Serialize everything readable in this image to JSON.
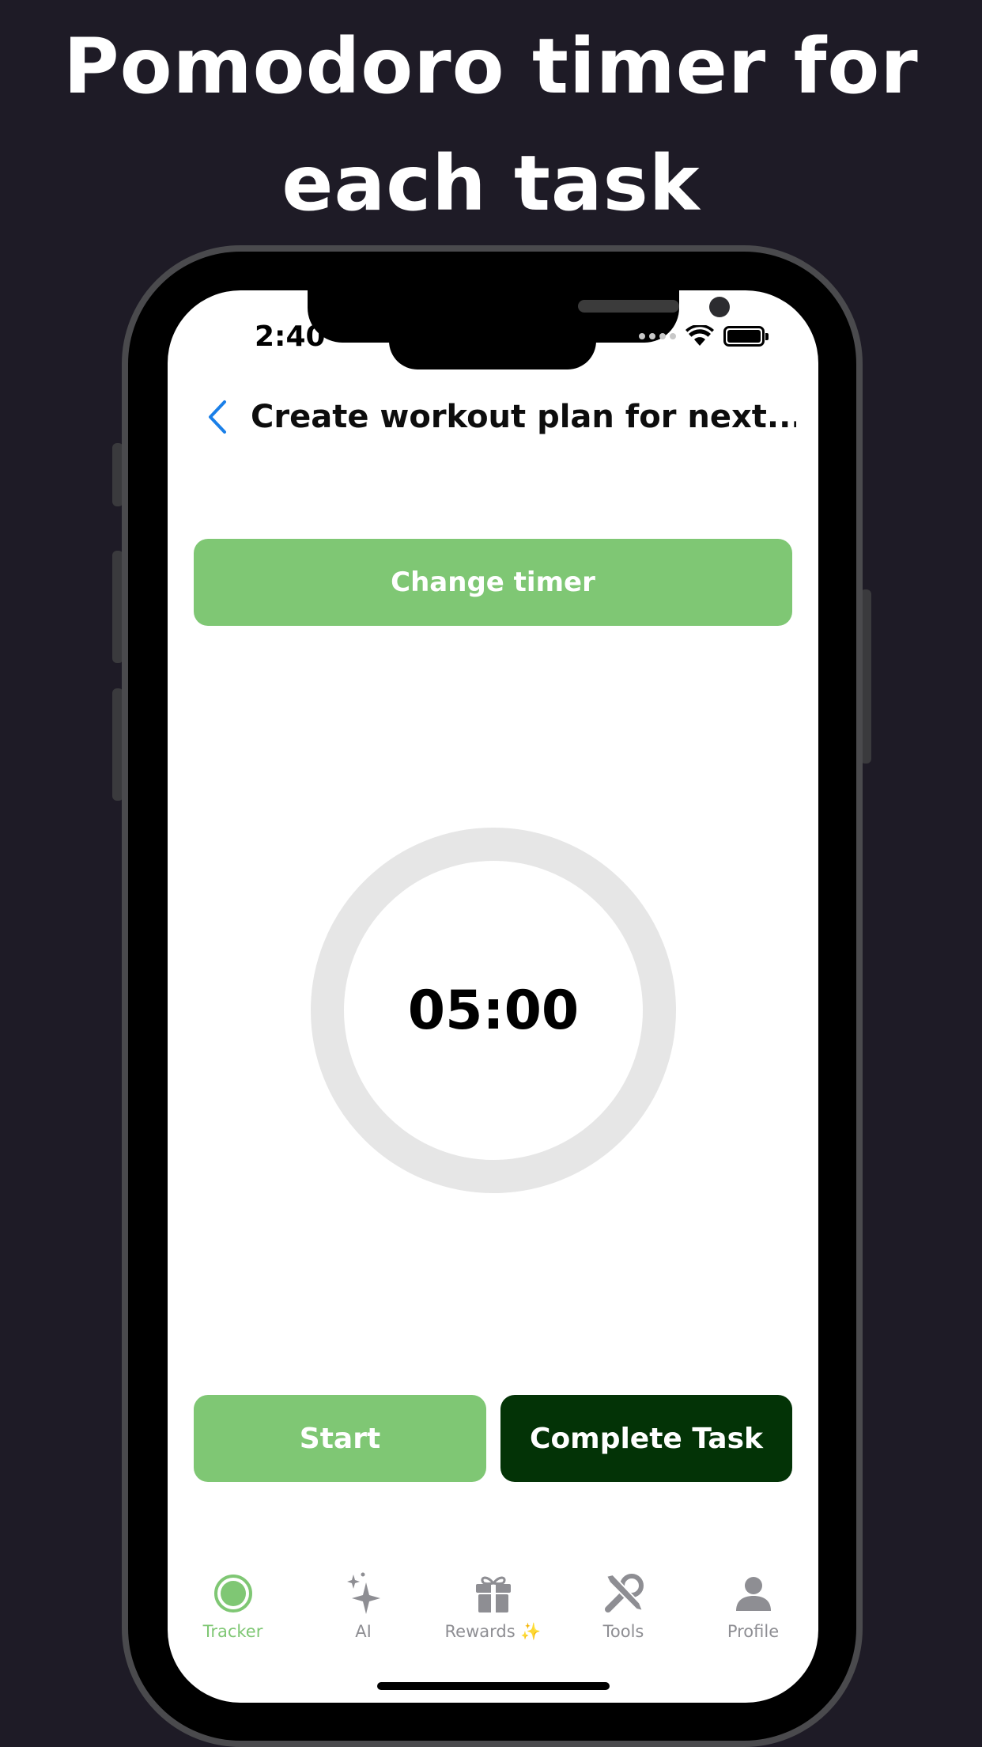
{
  "headline": {
    "line1": "Pomodoro timer for",
    "line2": "each task"
  },
  "status_bar": {
    "time": "2:40",
    "icons": [
      "cellular-signal-icon",
      "wifi-icon",
      "battery-icon"
    ]
  },
  "header": {
    "back_icon": "chevron-left-icon",
    "title": "Create workout plan for next..."
  },
  "buttons": {
    "change_timer": "Change timer",
    "start": "Start",
    "complete_task": "Complete Task"
  },
  "timer": {
    "display": "05:00"
  },
  "tabbar": {
    "items": [
      {
        "label": "Tracker",
        "icon": "tracker-circle-icon",
        "active": true
      },
      {
        "label": "AI",
        "icon": "sparkles-icon",
        "active": false
      },
      {
        "label": "Rewards ✨",
        "icon": "gift-icon",
        "active": false
      },
      {
        "label": "Tools",
        "icon": "tools-icon",
        "active": false
      },
      {
        "label": "Profile",
        "icon": "person-icon",
        "active": false
      }
    ]
  },
  "colors": {
    "background": "#1e1b26",
    "accent_green": "#7fc774",
    "dark_green": "#033306",
    "ring": "#e6e6e6",
    "back_blue": "#1a7fe8",
    "tab_inactive": "#8e8e93"
  }
}
